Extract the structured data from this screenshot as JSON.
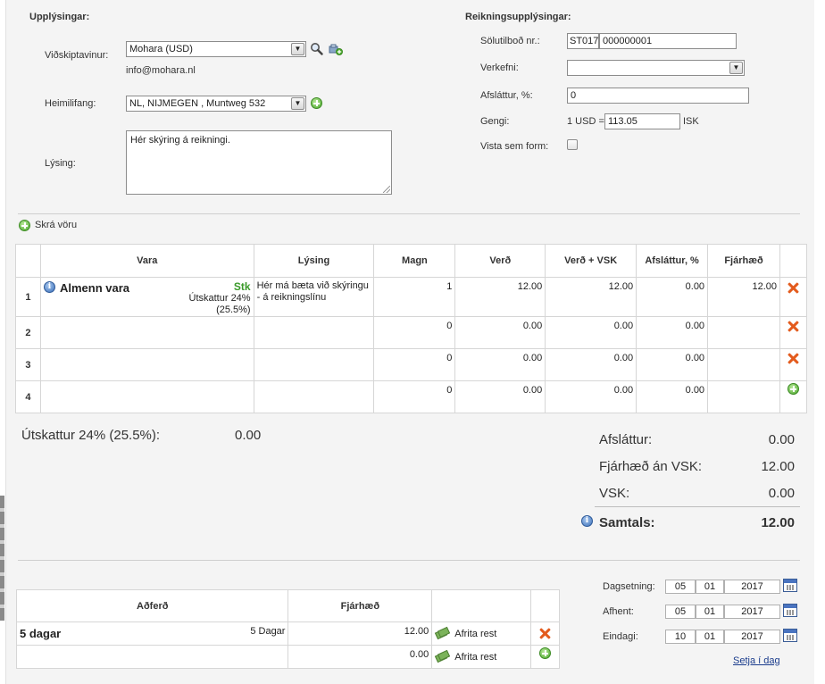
{
  "info": {
    "title": "Upplýsingar:",
    "customer_label": "Viðskiptavinur:",
    "customer_value": "Mohara  (USD)",
    "customer_email": "info@mohara.nl",
    "address_label": "Heimilifang:",
    "address_value": "NL, NIJMEGEN , Muntweg 532",
    "description_label": "Lýsing:",
    "description_value": "Hér skýring á reikningi."
  },
  "invoice": {
    "title": "Reikningsupplýsingar:",
    "offer_label": "Sölutilboð nr.:",
    "offer_prefix": "ST017",
    "offer_number": "000000001",
    "project_label": "Verkefni:",
    "project_value": "",
    "discount_label": "Afsláttur, %:",
    "discount_value": "0",
    "rate_label": "Gengi:",
    "rate_prefix": "1 USD =",
    "rate_value": "113.05",
    "rate_currency": "ISK",
    "save_form_label": "Vista sem form:"
  },
  "add_product_label": "Skrá vöru",
  "lines": {
    "headers": [
      "Vara",
      "Lýsing",
      "Magn",
      "Verð",
      "Verð + VSK",
      "Afsláttur, %",
      "Fjárhæð"
    ],
    "rows": [
      {
        "num": "1",
        "product": "Almenn vara",
        "unit": "Stk",
        "tax": "Útskattur 24% (25.5%)",
        "description": "Hér má bæta við skýringu - á reikningslínu",
        "qty": "1",
        "price": "12.00",
        "price_vat": "12.00",
        "discount": "0.00",
        "amount": "12.00",
        "action": "delete"
      },
      {
        "num": "2",
        "product": "",
        "unit": "",
        "tax": "",
        "description": "",
        "qty": "0",
        "price": "0.00",
        "price_vat": "0.00",
        "discount": "0.00",
        "amount": "",
        "action": "delete"
      },
      {
        "num": "3",
        "product": "",
        "unit": "",
        "tax": "",
        "description": "",
        "qty": "0",
        "price": "0.00",
        "price_vat": "0.00",
        "discount": "0.00",
        "amount": "",
        "action": "delete"
      },
      {
        "num": "4",
        "product": "",
        "unit": "",
        "tax": "",
        "description": "",
        "qty": "0",
        "price": "0.00",
        "price_vat": "0.00",
        "discount": "0.00",
        "amount": "",
        "action": "add"
      }
    ]
  },
  "tax_summary": {
    "label": "Útskattur 24% (25.5%):",
    "value": "0.00"
  },
  "totals": {
    "discount_label": "Afsláttur:",
    "discount_value": "0.00",
    "net_label": "Fjárhæð án VSK:",
    "net_value": "12.00",
    "vat_label": "VSK:",
    "vat_value": "0.00",
    "total_label": "Samtals:",
    "total_value": "12.00"
  },
  "payments": {
    "headers": [
      "Aðferð",
      "Fjárhæð"
    ],
    "rows": [
      {
        "method": "5 dagar",
        "method_desc": "5 Dagar",
        "amount": "12.00",
        "copy_label": "Afrita rest",
        "action": "delete"
      },
      {
        "method": "",
        "method_desc": "",
        "amount": "0.00",
        "copy_label": "Afrita rest",
        "action": "add"
      }
    ]
  },
  "dates": {
    "date_label": "Dagsetning:",
    "date": [
      "05",
      "01",
      "2017"
    ],
    "delivered_label": "Afhent:",
    "delivered": [
      "05",
      "01",
      "2017"
    ],
    "due_label": "Eindagi:",
    "due": [
      "10",
      "01",
      "2017"
    ],
    "set_in_days_label": "Setja í dag"
  },
  "icons": {
    "search": "search-icon",
    "add_customer": "add-user-icon",
    "add": "plus-circle-icon",
    "delete": "delete-x-icon",
    "info": "info-icon",
    "calendar": "calendar-icon",
    "money": "money-icon"
  },
  "colors": {
    "unit_green": "#3a9a2a",
    "delete_orange": "#e35b1d",
    "link_blue": "#1a3c8c"
  }
}
